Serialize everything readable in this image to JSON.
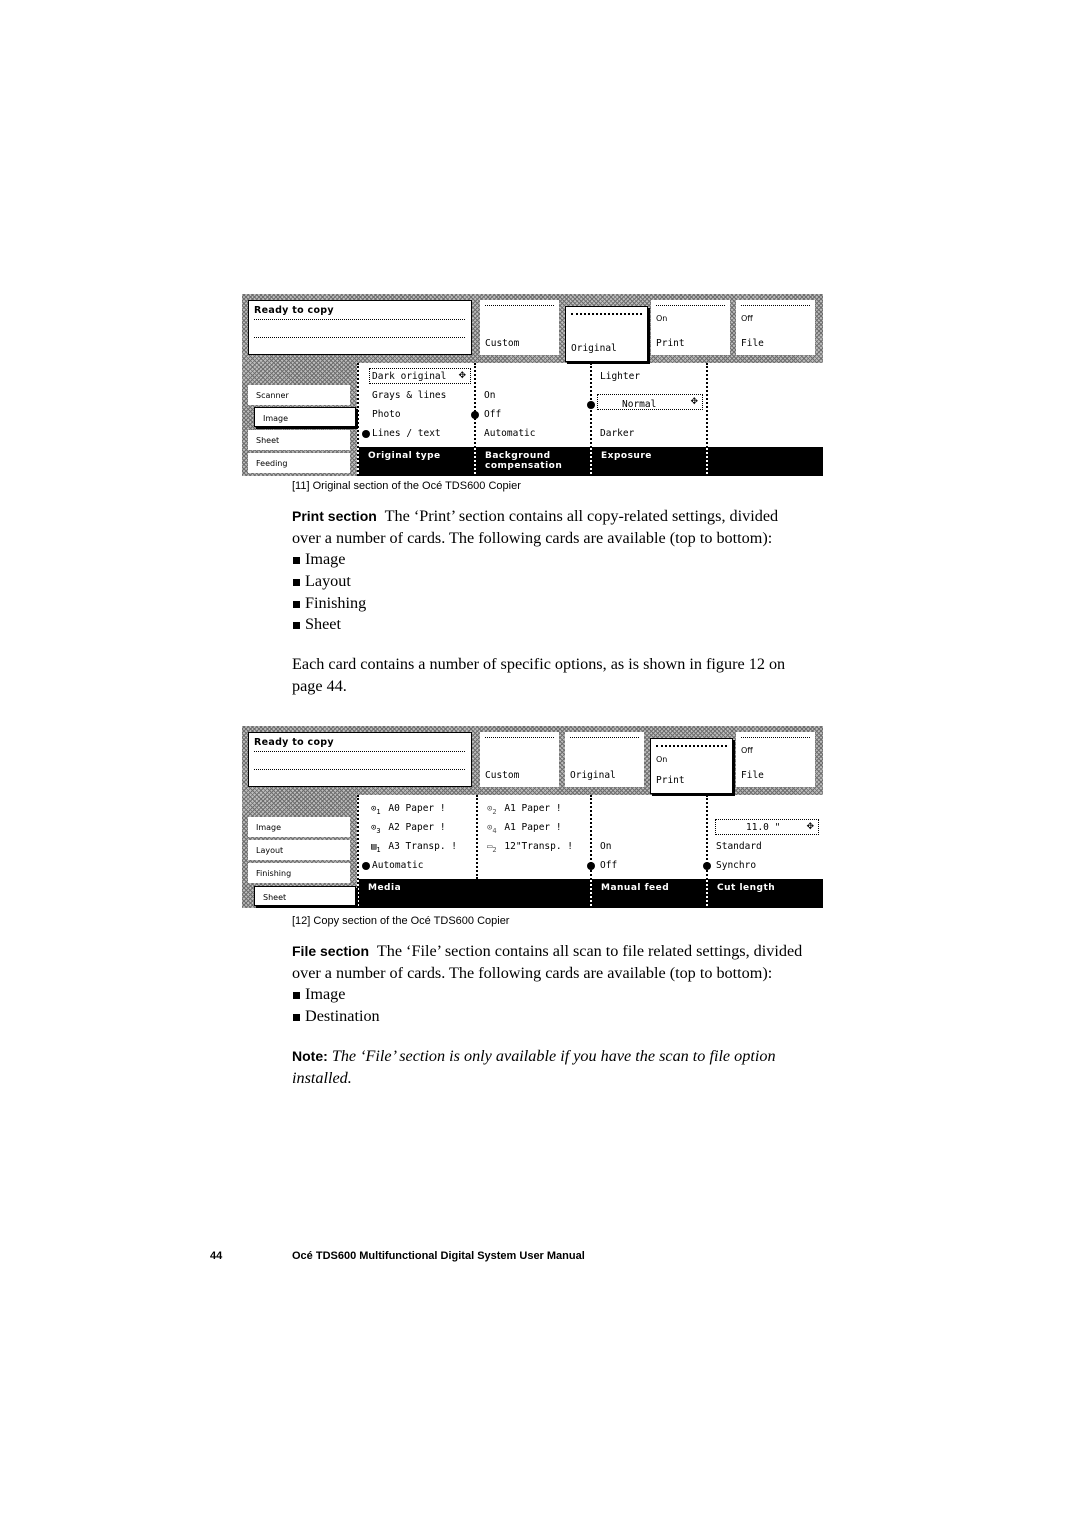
{
  "figure11": {
    "status": {
      "title": "Ready to copy"
    },
    "tabs": [
      {
        "small": "",
        "label": "Custom",
        "active": false
      },
      {
        "small": "",
        "label": "Original",
        "active": true
      },
      {
        "small": "On",
        "label": "Print",
        "active": false
      },
      {
        "small": "Off",
        "label": "File",
        "active": false
      }
    ],
    "side_menu": [
      {
        "label": "Scanner",
        "active": false
      },
      {
        "label": "Image",
        "active": true
      },
      {
        "label": "Sheet",
        "active": false
      },
      {
        "label": "Feeding",
        "active": false
      }
    ],
    "columns": [
      {
        "title": "Original type",
        "options": [
          "Dark original",
          "Grays & lines",
          "Photo",
          "Lines / text"
        ],
        "boxed_option": "Dark original",
        "selected": "Lines / text"
      },
      {
        "title_line1": "Background",
        "title_line2": "compensation",
        "options": [
          "On",
          "Off",
          "Automatic"
        ],
        "selected": "Off"
      },
      {
        "title": "Exposure",
        "options": [
          "Lighter",
          "Normal",
          "Darker"
        ],
        "boxed_option": "Normal",
        "selected": "Normal"
      },
      {
        "title": ""
      }
    ],
    "caption": "[11] Original section of the Océ TDS600 Copier"
  },
  "print_section": {
    "lead": "Print section",
    "text_line1": "The ‘Print’ section contains all copy-related settings, divided",
    "text_line2": "over a number of cards. The following cards are available (top to bottom):",
    "items": [
      "Image",
      "Layout",
      "Finishing",
      "Sheet"
    ],
    "para2_line1": "Each card contains a number of specific options, as is shown in figure 12 on",
    "para2_line2": "page 44."
  },
  "figure12": {
    "status": {
      "title": "Ready to copy"
    },
    "tabs": [
      {
        "small": "",
        "label": "Custom",
        "active": false
      },
      {
        "small": "",
        "label": "Original",
        "active": false
      },
      {
        "small": "On",
        "label": "Print",
        "active": true
      },
      {
        "small": "Off",
        "label": "File",
        "active": false
      }
    ],
    "side_menu": [
      {
        "label": "Image",
        "active": false
      },
      {
        "label": "Layout",
        "active": false
      },
      {
        "label": "Finishing",
        "active": false
      },
      {
        "label": "Sheet",
        "active": true
      }
    ],
    "media": {
      "title": "Media",
      "left": [
        {
          "icon": "roll-icon",
          "num": "1",
          "text": "A0 Paper !"
        },
        {
          "icon": "roll-icon",
          "num": "3",
          "text": "A2 Paper !"
        },
        {
          "icon": "sheet-tray-icon",
          "num": "1",
          "text": "A3 Transp. !"
        }
      ],
      "right": [
        {
          "icon": "roll-icon",
          "num": "2",
          "text": "A1 Paper !"
        },
        {
          "icon": "roll-icon",
          "num": "4",
          "text": "A1 Paper !"
        },
        {
          "icon": "sheet-tray-icon",
          "num": "2",
          "text": "12\"Transp. !"
        }
      ],
      "automatic": "Automatic",
      "selected": "Automatic"
    },
    "manual_feed": {
      "title": "Manual feed",
      "options": [
        "On",
        "Off"
      ],
      "selected": "Off"
    },
    "cut_length": {
      "title": "Cut length",
      "value": "11.0 \"",
      "options": [
        "Standard",
        "Synchro"
      ],
      "selected": "Synchro"
    },
    "caption": "[12] Copy section of the Océ TDS600 Copier"
  },
  "file_section": {
    "lead": "File section",
    "text_line1": "The ‘File’ section contains all scan to file related settings, divided",
    "text_line2": "over a number of cards. The following cards are available (top to bottom):",
    "items": [
      "Image",
      "Destination"
    ]
  },
  "note": {
    "lead": "Note:",
    "text_line1": "The ‘File’ section is only available if you have the scan to file option",
    "text_line2": "installed."
  },
  "footer": {
    "page_number": "44",
    "title": "Océ TDS600 Multifunctional Digital System User Manual"
  }
}
